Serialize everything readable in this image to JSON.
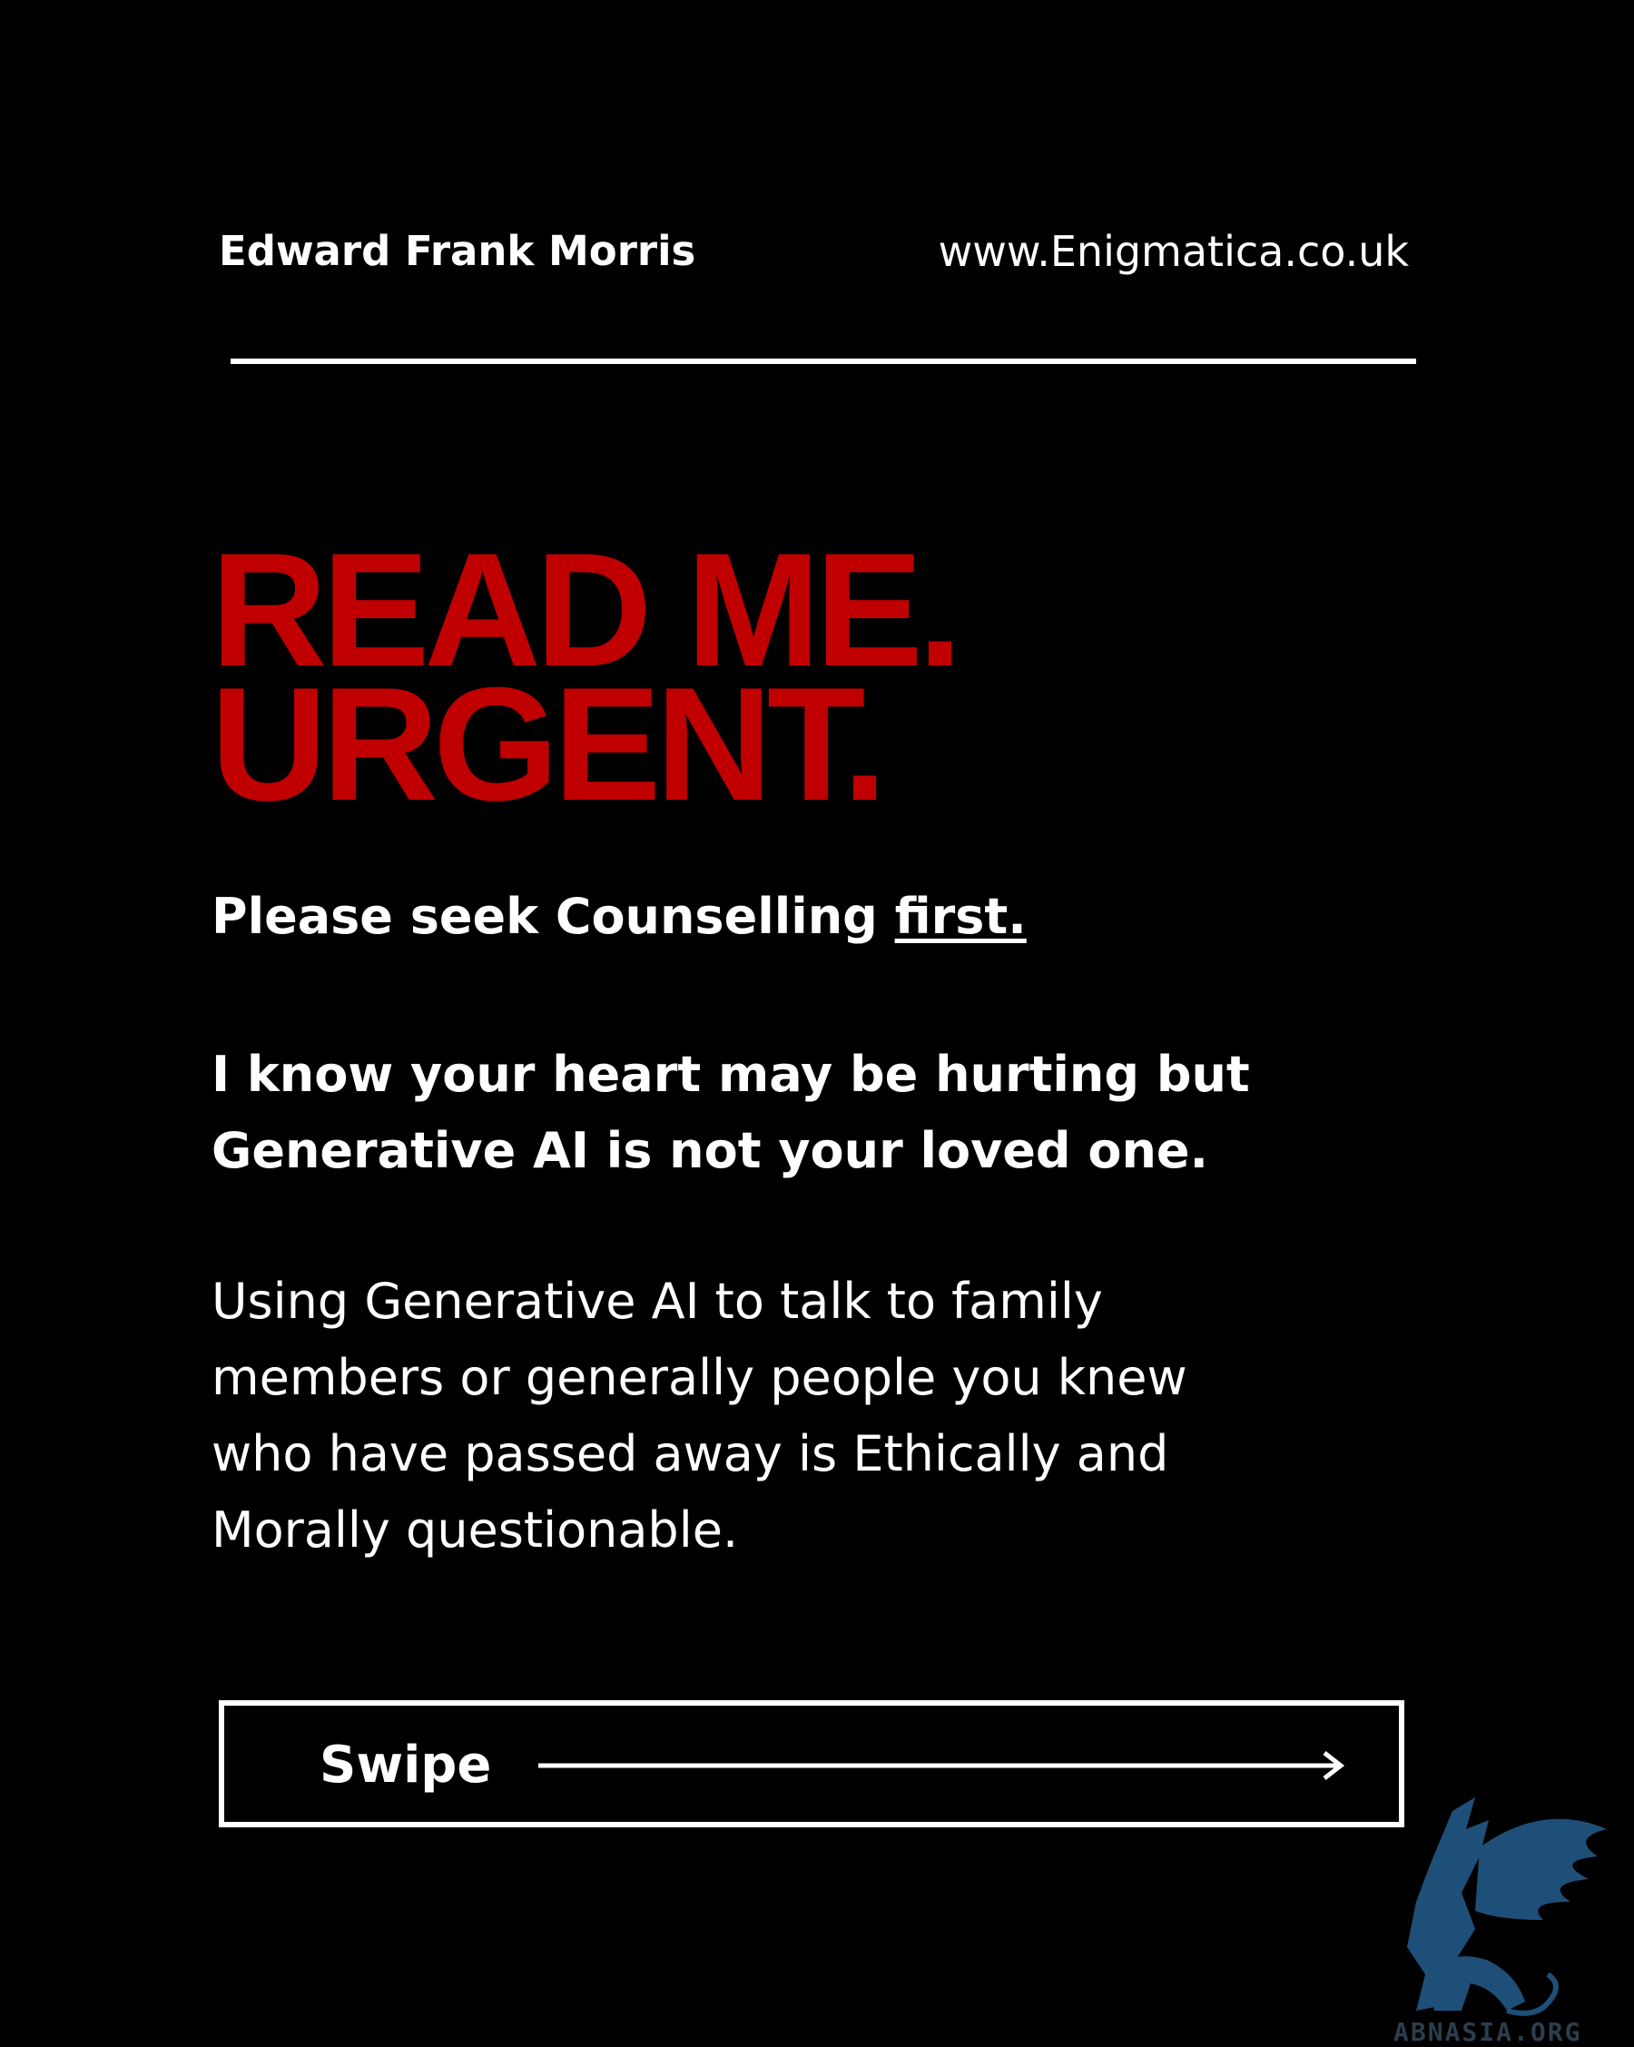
{
  "header": {
    "author": "Edward Frank Morris",
    "website": "www.Enigmatica.co.uk"
  },
  "headline": {
    "line1": "READ ME.",
    "line2": "URGENT."
  },
  "seek": {
    "text": "Please seek Counselling ",
    "emphasis": "first."
  },
  "heart": {
    "line1": "I know your heart may be hurting but",
    "line2": "Generative AI is not your loved one."
  },
  "body": {
    "lines": [
      "Using Generative AI to talk to family",
      "members or generally people you knew",
      "who have passed away is Ethically and",
      "Morally questionable."
    ]
  },
  "swipe": {
    "label": "Swipe",
    "icon": "arrow-right-icon"
  },
  "watermark": {
    "icon": "griffin-logo",
    "text": "ABNASIA.ORG"
  },
  "colors": {
    "background": "#000000",
    "headline": "#c00000",
    "text": "#ffffff",
    "watermark": "#1e4f78"
  }
}
